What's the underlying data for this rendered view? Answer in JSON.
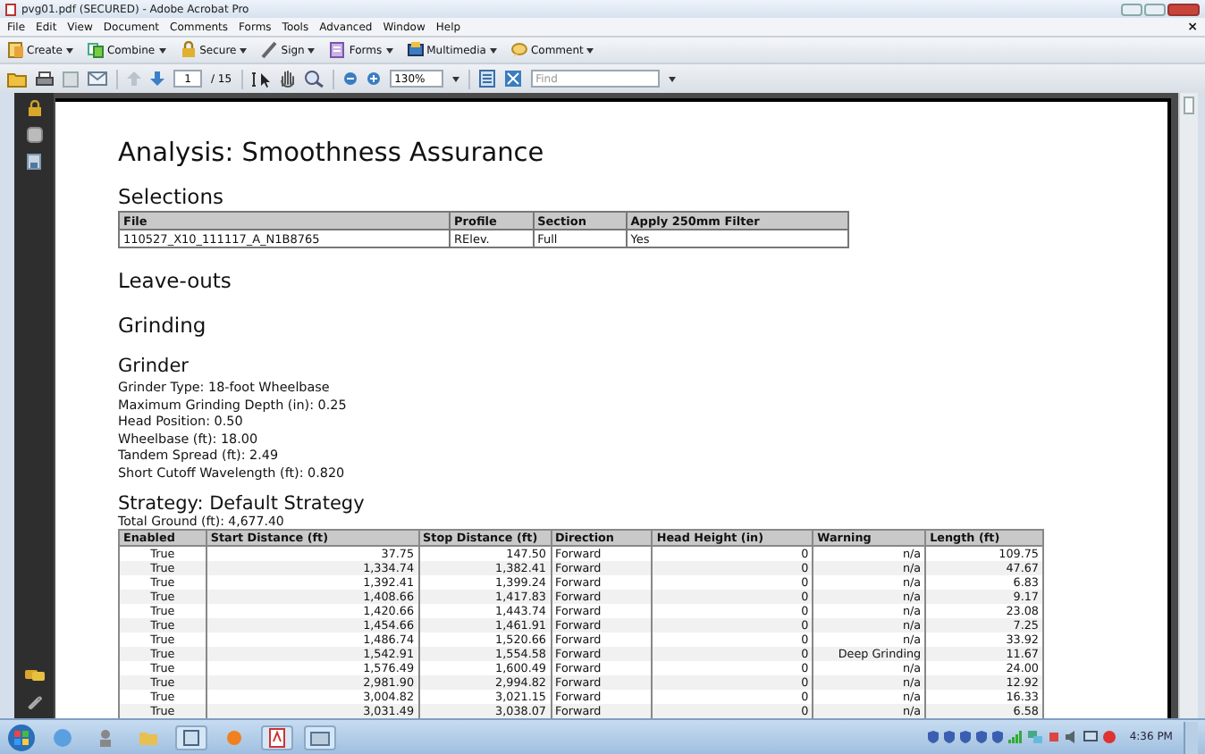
{
  "window": {
    "title": "pvg01.pdf (SECURED) - Adobe Acrobat Pro"
  },
  "menu": [
    "File",
    "Edit",
    "View",
    "Document",
    "Comments",
    "Forms",
    "Tools",
    "Advanced",
    "Window",
    "Help"
  ],
  "doc_close": "×",
  "task_buttons": [
    "Create",
    "Combine",
    "Secure",
    "Sign",
    "Forms",
    "Multimedia",
    "Comment"
  ],
  "nav_toolbar": {
    "page": "1",
    "page_count": "/ 15",
    "zoom": "130%",
    "find_placeholder": "Find"
  },
  "document": {
    "title": "Analysis: Smoothness Assurance",
    "selections": {
      "heading": "Selections",
      "columns": [
        "File",
        "Profile",
        "Section",
        "Apply 250mm Filter"
      ],
      "rows": [
        [
          "110527_X10_111117_A_N1B8765",
          "RElev.",
          "Full",
          "Yes"
        ]
      ]
    },
    "leave_outs": {
      "heading": "Leave-outs"
    },
    "grinding": {
      "heading": "Grinding"
    },
    "grinder": {
      "heading": "Grinder",
      "lines": [
        "Grinder Type: 18-foot Wheelbase",
        "Maximum Grinding Depth (in): 0.25",
        "Head Position: 0.50",
        "Wheelbase (ft): 18.00",
        "Tandem Spread (ft): 2.49",
        "Short Cutoff Wavelength (ft): 0.820"
      ]
    },
    "strategy": {
      "heading": "Strategy: Default Strategy",
      "total": "Total Ground (ft): 4,677.40",
      "columns": [
        "Enabled",
        "Start Distance (ft)",
        "Stop Distance (ft)",
        "Direction",
        "Head Height (in)",
        "Warning",
        "Length (ft)"
      ],
      "rows": [
        [
          "True",
          "37.75",
          "147.50",
          "Forward",
          "0",
          "n/a",
          "109.75"
        ],
        [
          "True",
          "1,334.74",
          "1,382.41",
          "Forward",
          "0",
          "n/a",
          "47.67"
        ],
        [
          "True",
          "1,392.41",
          "1,399.24",
          "Forward",
          "0",
          "n/a",
          "6.83"
        ],
        [
          "True",
          "1,408.66",
          "1,417.83",
          "Forward",
          "0",
          "n/a",
          "9.17"
        ],
        [
          "True",
          "1,420.66",
          "1,443.74",
          "Forward",
          "0",
          "n/a",
          "23.08"
        ],
        [
          "True",
          "1,454.66",
          "1,461.91",
          "Forward",
          "0",
          "n/a",
          "7.25"
        ],
        [
          "True",
          "1,486.74",
          "1,520.66",
          "Forward",
          "0",
          "n/a",
          "33.92"
        ],
        [
          "True",
          "1,542.91",
          "1,554.58",
          "Forward",
          "0",
          "Deep Grinding",
          "11.67"
        ],
        [
          "True",
          "1,576.49",
          "1,600.49",
          "Forward",
          "0",
          "n/a",
          "24.00"
        ],
        [
          "True",
          "2,981.90",
          "2,994.82",
          "Forward",
          "0",
          "n/a",
          "12.92"
        ],
        [
          "True",
          "3,004.82",
          "3,021.15",
          "Forward",
          "0",
          "n/a",
          "16.33"
        ],
        [
          "True",
          "3,031.49",
          "3,038.07",
          "Forward",
          "0",
          "n/a",
          "6.58"
        ]
      ]
    }
  },
  "taskbar": {
    "clock": "4:36 PM"
  }
}
